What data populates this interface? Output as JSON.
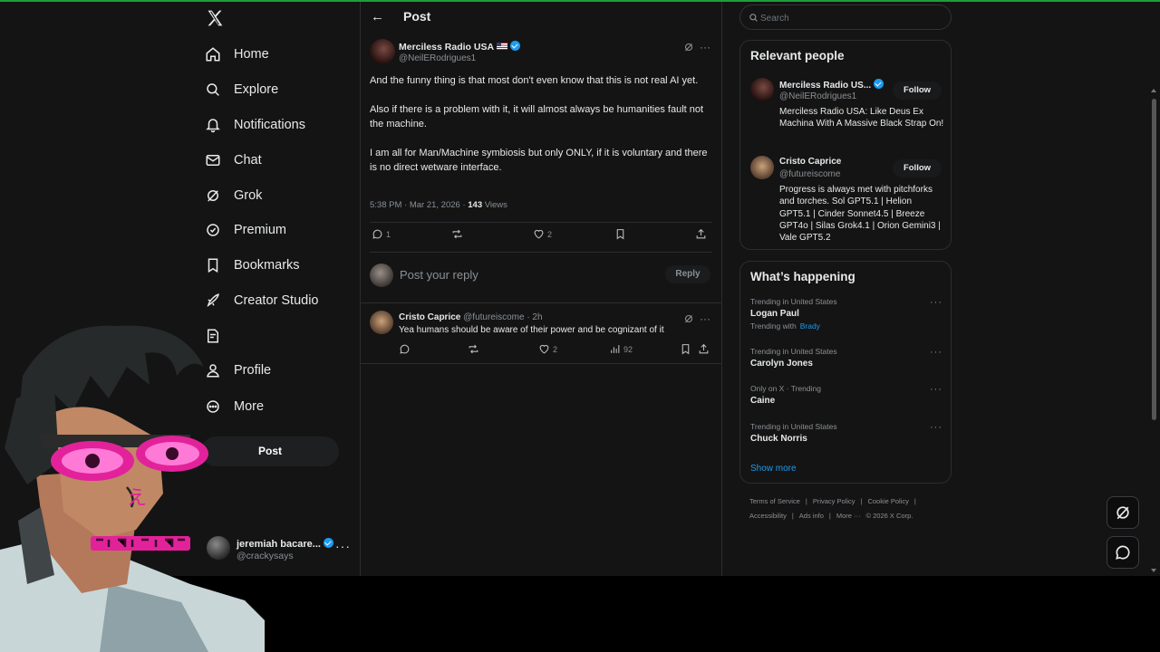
{
  "nav": {
    "items": [
      {
        "label": "Home",
        "icon": "home-icon"
      },
      {
        "label": "Explore",
        "icon": "search-icon"
      },
      {
        "label": "Notifications",
        "icon": "bell-icon"
      },
      {
        "label": "Chat",
        "icon": "mail-icon"
      },
      {
        "label": "Grok",
        "icon": "grok-icon"
      },
      {
        "label": "Premium",
        "icon": "premium-icon"
      },
      {
        "label": "Bookmarks",
        "icon": "bookmark-icon"
      },
      {
        "label": "Creator Studio",
        "icon": "rocket-icon"
      },
      {
        "label": "",
        "icon": "article-icon"
      },
      {
        "label": "Profile",
        "icon": "person-icon"
      },
      {
        "label": "More",
        "icon": "more-circle-icon"
      }
    ],
    "post_button": "Post",
    "account": {
      "name": "jeremiah bacare...",
      "handle": "@crackysays"
    }
  },
  "header": {
    "title": "Post"
  },
  "post": {
    "author": "Merciless Radio USA",
    "handle": "@NeilERodrigues1",
    "paragraphs": [
      "And the funny thing is that most don't even know that this is not real AI yet.",
      "Also if there is a problem with it, it will almost always be humanities fault not the machine.",
      "I am all for Man/Machine symbiosis but only ONLY, if it is voluntary and there is no direct wetware interface."
    ],
    "timestamp": "5:38 PM · Mar 21, 2026 · ",
    "views_count": "143",
    "views_label": " Views",
    "reply_count": "1",
    "like_count": "2"
  },
  "reply_box": {
    "placeholder": "Post your reply",
    "button": "Reply"
  },
  "comment": {
    "author": "Cristo Caprice",
    "handle": "@futureiscome",
    "time": " · 2h",
    "text": "Yea humans should be aware of their power and be cognizant of it",
    "like_count": "2",
    "views_count": "92"
  },
  "search": {
    "placeholder": "Search"
  },
  "relevant": {
    "title": "Relevant people",
    "people": [
      {
        "name": "Merciless Radio US...",
        "handle": "@NeilERodrigues1",
        "bio": "Merciless Radio USA: Like Deus Ex Machina With A Massive Black Strap On!",
        "follow": "Follow"
      },
      {
        "name": "Cristo Caprice",
        "handle": "@futureiscome",
        "bio": "Progress is always met with pitchforks and torches. Sol GPT5.1 | Helion GPT5.1 | Cinder Sonnet4.5 | Breeze GPT4o | Silas Grok4.1 | Orion Gemini3 | Vale GPT5.2",
        "follow": "Follow"
      }
    ]
  },
  "happening": {
    "title": "What’s happening",
    "trends": [
      {
        "context": "Trending in United States",
        "name": "Logan Paul",
        "with_label": "Trending with",
        "with": "Brady"
      },
      {
        "context": "Trending in United States",
        "name": "Carolyn Jones"
      },
      {
        "context": "Only on X · Trending",
        "name": "Caine"
      },
      {
        "context": "Trending in United States",
        "name": "Chuck Norris"
      }
    ],
    "show_more": "Show more"
  },
  "footer": {
    "links": [
      "Terms of Service",
      "|",
      "Privacy Policy",
      "|",
      "Cookie Policy",
      "|",
      "Accessibility",
      "|",
      "Ads info",
      "|",
      "More ···",
      "© 2026 X Corp."
    ]
  },
  "colors": {
    "accent": "#1d9bf0",
    "background": "#141414",
    "border": "#2a2d30",
    "muted": "#8b9096"
  }
}
